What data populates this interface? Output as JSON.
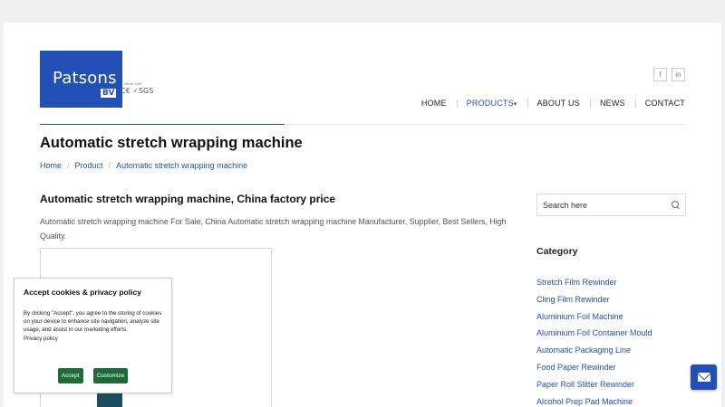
{
  "logo": {
    "name": "Patsons",
    "bv": "BV",
    "since": "Since 1987",
    "certs": "C€",
    "certs_sgs": "SGS"
  },
  "social": {
    "facebook": "f",
    "linkedin": "in"
  },
  "nav": {
    "items": [
      {
        "label": "HOME"
      },
      {
        "label": "PRODUCTS"
      },
      {
        "label": "ABOUT US"
      },
      {
        "label": "NEWS"
      },
      {
        "label": "CONTACT"
      }
    ]
  },
  "page": {
    "title": "Automatic stretch wrapping machine",
    "breadcrumb": [
      "Home",
      "Product",
      "Automatic stretch wrapping machine"
    ]
  },
  "product": {
    "heading": "Automatic stretch wrapping machine, China factory price",
    "description": "Automatic stretch wrapping machine For Sale, China Automatic stretch wrapping machine Manufacturer, Supplier, Best Sellers, High Quality."
  },
  "sidebar": {
    "search_placeholder": "Search here",
    "category_title": "Category",
    "categories": [
      "Stretch Film Rewinder",
      "Cling Film Rewinder",
      "Aluminium Foil Machine",
      "Aluminium Foil Container Mould",
      "Automatic Packaging Line",
      "Food Paper Rewinder",
      "Paper Roll Slitter Rewinder",
      "Alcohol Prep Pad Machine"
    ]
  },
  "cookie": {
    "title": "Accept cookies & privacy policy",
    "text": "By clicking \"Accept\", you agree to the storing of cookies on your device to enhance site navigation, analyze site usage, and assist in our marketing efforts.",
    "link": "Privacy policy",
    "accept": "Accept",
    "customize": "Customize"
  },
  "colors": {
    "brand": "#2350b4",
    "accept_green": "#1e6b3a"
  },
  "icons": {
    "search": "search-icon",
    "mail": "envelope-icon",
    "caret": "caret-down-icon"
  }
}
